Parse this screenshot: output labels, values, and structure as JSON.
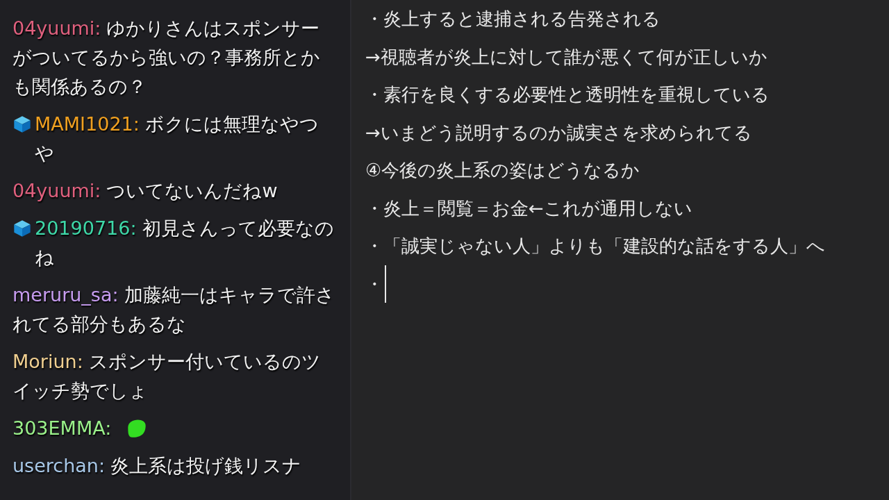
{
  "chat": {
    "messages": [
      {
        "user": "04yuumi:",
        "color": "#e0607e",
        "badge": false,
        "kind": "text",
        "text": "ゆかりさんはスポンサーがついてるから強いの？事務所とかも関係あるの？"
      },
      {
        "user": "MAMI1021:",
        "color": "#f0a020",
        "badge": true,
        "kind": "text",
        "text": "ボクには無理なやつや"
      },
      {
        "user": "04yuumi:",
        "color": "#e0607e",
        "badge": false,
        "kind": "text",
        "text": "ついてないんだねw"
      },
      {
        "user": "20190716:",
        "color": "#3ed8a8",
        "badge": true,
        "kind": "text",
        "text": "初見さんって必要なのね"
      },
      {
        "user": "meruru_sa:",
        "color": "#c79cf0",
        "badge": false,
        "kind": "text",
        "text": "加藤純一はキャラで許されてる部分もあるな"
      },
      {
        "user": "Moriun:",
        "color": "#f0cf90",
        "badge": false,
        "kind": "text",
        "text": "スポンサー付いているのツイッチ勢でしょ"
      },
      {
        "user": "303EMMA:",
        "color": "#9af08a",
        "badge": false,
        "kind": "emote"
      },
      {
        "user": "userchan:",
        "color": "#a8c8e8",
        "badge": false,
        "kind": "text",
        "text": "炎上系は投げ銭リスナ"
      }
    ]
  },
  "notes": {
    "lines": [
      {
        "text": "・炎上すると逮捕される告発される",
        "caret": false
      },
      {
        "text": "→視聴者が炎上に対して誰が悪くて何が正しいか",
        "caret": false
      },
      {
        "text": "・素行を良くする必要性と透明性を重視している",
        "caret": false
      },
      {
        "text": "→いまどう説明するのか誠実さを求められてる",
        "caret": false
      },
      {
        "text": "④今後の炎上系の姿はどうなるか",
        "caret": false
      },
      {
        "text": "・炎上＝閲覧＝お金←これが通用しない",
        "caret": false
      },
      {
        "text": "・「誠実じゃない人」よりも「建設的な話をする人」へ",
        "caret": false
      },
      {
        "text": "・",
        "caret": true
      }
    ]
  }
}
